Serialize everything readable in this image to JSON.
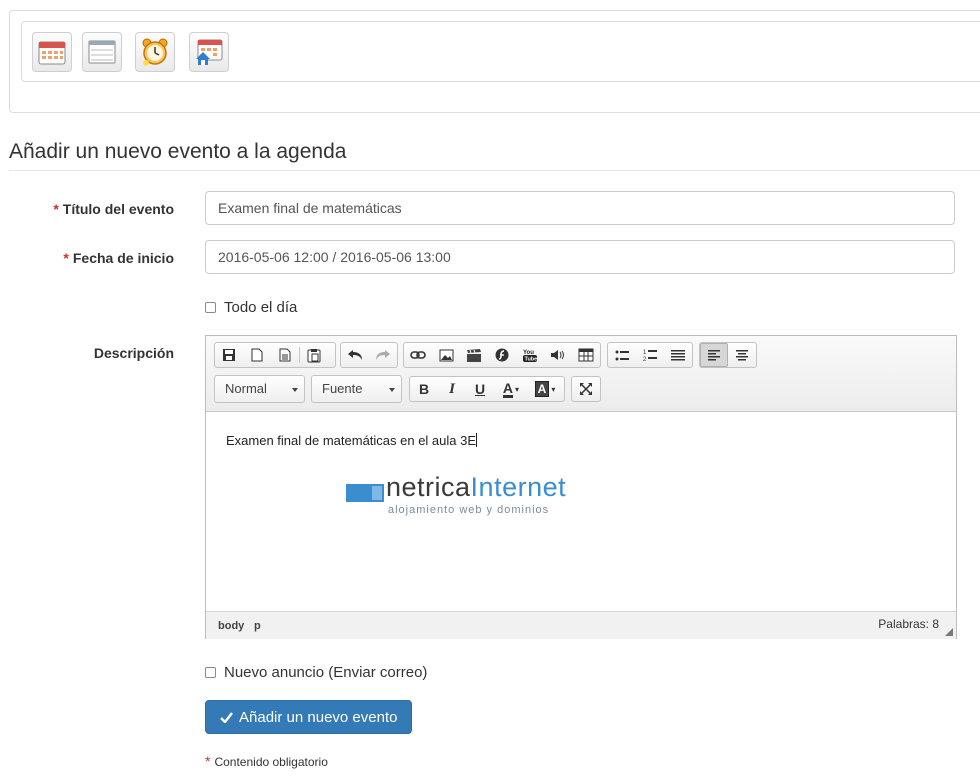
{
  "toolbar": {
    "buttons": [
      {
        "icon": "calendar-month-icon"
      },
      {
        "icon": "calendar-list-icon"
      },
      {
        "icon": "alarm-clock-icon"
      },
      {
        "icon": "calendar-home-icon"
      }
    ]
  },
  "page": {
    "title": "Añadir un nuevo evento a la agenda"
  },
  "form": {
    "required_marker": "*",
    "title_label": "Título del evento",
    "title_value": "Examen final de matemáticas",
    "date_label": "Fecha de inicio",
    "date_value": "2016-05-06 12:00 / 2016-05-06 13:00",
    "all_day_label": "Todo el día",
    "all_day_checked": false,
    "description_label": "Descripción",
    "announcement_label": "Nuevo anuncio (Enviar correo)",
    "announcement_checked": false,
    "submit_label": "Añadir un nuevo evento",
    "required_note": "Contenido obligatorio"
  },
  "editor": {
    "format_select": "Normal",
    "font_select": "Fuente",
    "bold_label": "B",
    "italic_label": "I",
    "underline_label": "U",
    "text_color_label": "A",
    "bg_color_label": "A",
    "content_text": "Examen final de matemáticas en el aula 3E",
    "logo": {
      "part1": "netrica",
      "part2": "Internet",
      "tagline": "alojamiento web y dominios"
    },
    "path": [
      "body",
      "p"
    ],
    "word_count": "Palabras: 8"
  },
  "colors": {
    "primary": "#337ab7",
    "required": "#c9302c",
    "logo_blue": "#3a8ed0"
  }
}
